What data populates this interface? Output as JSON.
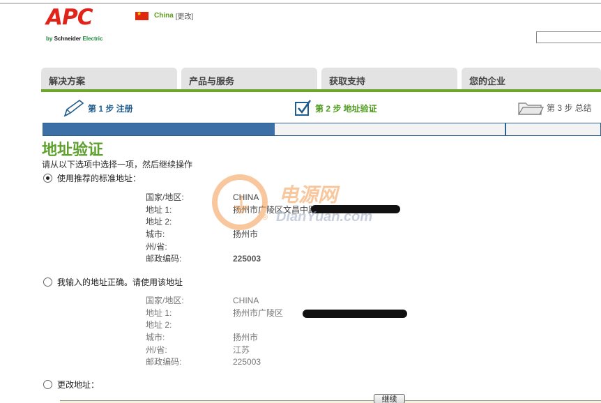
{
  "brand": {
    "logo_text": "APC",
    "by": "by",
    "parent": "Schneider",
    "parent_suffix": "Electric"
  },
  "country": {
    "name": "China",
    "change_label": "[更改]",
    "flag_icon": "china-flag-icon"
  },
  "nav": {
    "tabs": [
      {
        "label": "解决方案"
      },
      {
        "label": "产品与服务"
      },
      {
        "label": "获取支持"
      },
      {
        "label": "您的企业"
      }
    ]
  },
  "steps": {
    "step1": "第 1 步 注册",
    "step2": "第 2 步 地址验证",
    "step3": "第 3 步 总结"
  },
  "progress": {
    "value": 0.415
  },
  "page": {
    "title": "地址验证",
    "instruction": "请从以下选项中选择一项，然后继续操作"
  },
  "options": {
    "recommended": {
      "label": "使用推荐的标准地址：",
      "selected": true,
      "fields": [
        {
          "label": "国家/地区:",
          "value": "CHINA"
        },
        {
          "label": "地址 1:",
          "value": "扬州市广陵区文昌中路"
        },
        {
          "label": "地址 2:",
          "value": ""
        },
        {
          "label": "城市:",
          "value": "扬州市"
        },
        {
          "label": "州/省:",
          "value": ""
        },
        {
          "label": "邮政编码:",
          "value": "225003"
        }
      ]
    },
    "entered": {
      "label": "我输入的地址正确。请使用该地址",
      "selected": false,
      "fields": [
        {
          "label": "国家/地区:",
          "value": "CHINA"
        },
        {
          "label": "地址 1:",
          "value": "扬州市广陵区"
        },
        {
          "label": "地址 2:",
          "value": ""
        },
        {
          "label": "城市:",
          "value": "扬州市"
        },
        {
          "label": "州/省:",
          "value": "江苏"
        },
        {
          "label": "邮政编码:",
          "value": "225003"
        }
      ]
    },
    "change": {
      "label": "更改地址：",
      "selected": false
    }
  },
  "watermark": {
    "cn": "电源网",
    "en": "DianYuan.com",
    "reg": "®"
  },
  "continue_label": "继续",
  "colors": {
    "brand_red": "#e2231a",
    "accent_green": "#6ca72a",
    "step_blue": "#1f5c8c",
    "progress_blue": "#3b6fa6"
  }
}
